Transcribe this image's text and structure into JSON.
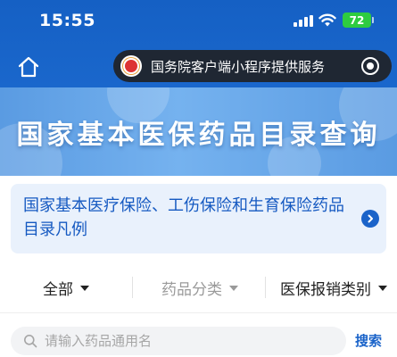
{
  "status_bar": {
    "time": "15:55",
    "battery": "72"
  },
  "nav": {
    "capsule_text": "国务院客户端小程序提供服务",
    "icons": {
      "home": "home-icon",
      "record": "record-icon",
      "logo": "gov-client-logo"
    }
  },
  "banner": {
    "title": "国家基本医保药品目录查询"
  },
  "notice": {
    "text": "国家基本医疗保险、工伤保险和生育保险药品目录凡例"
  },
  "filters": {
    "items": [
      {
        "label": "全部"
      },
      {
        "label": "药品分类"
      },
      {
        "label": "医保报销类别"
      }
    ]
  },
  "search": {
    "placeholder": "请输入药品通用名",
    "button_label": "搜索"
  },
  "colors": {
    "brand_blue": "#1a63c9",
    "battery_green": "#2ecc40",
    "capsule_bg": "#1f2733"
  }
}
